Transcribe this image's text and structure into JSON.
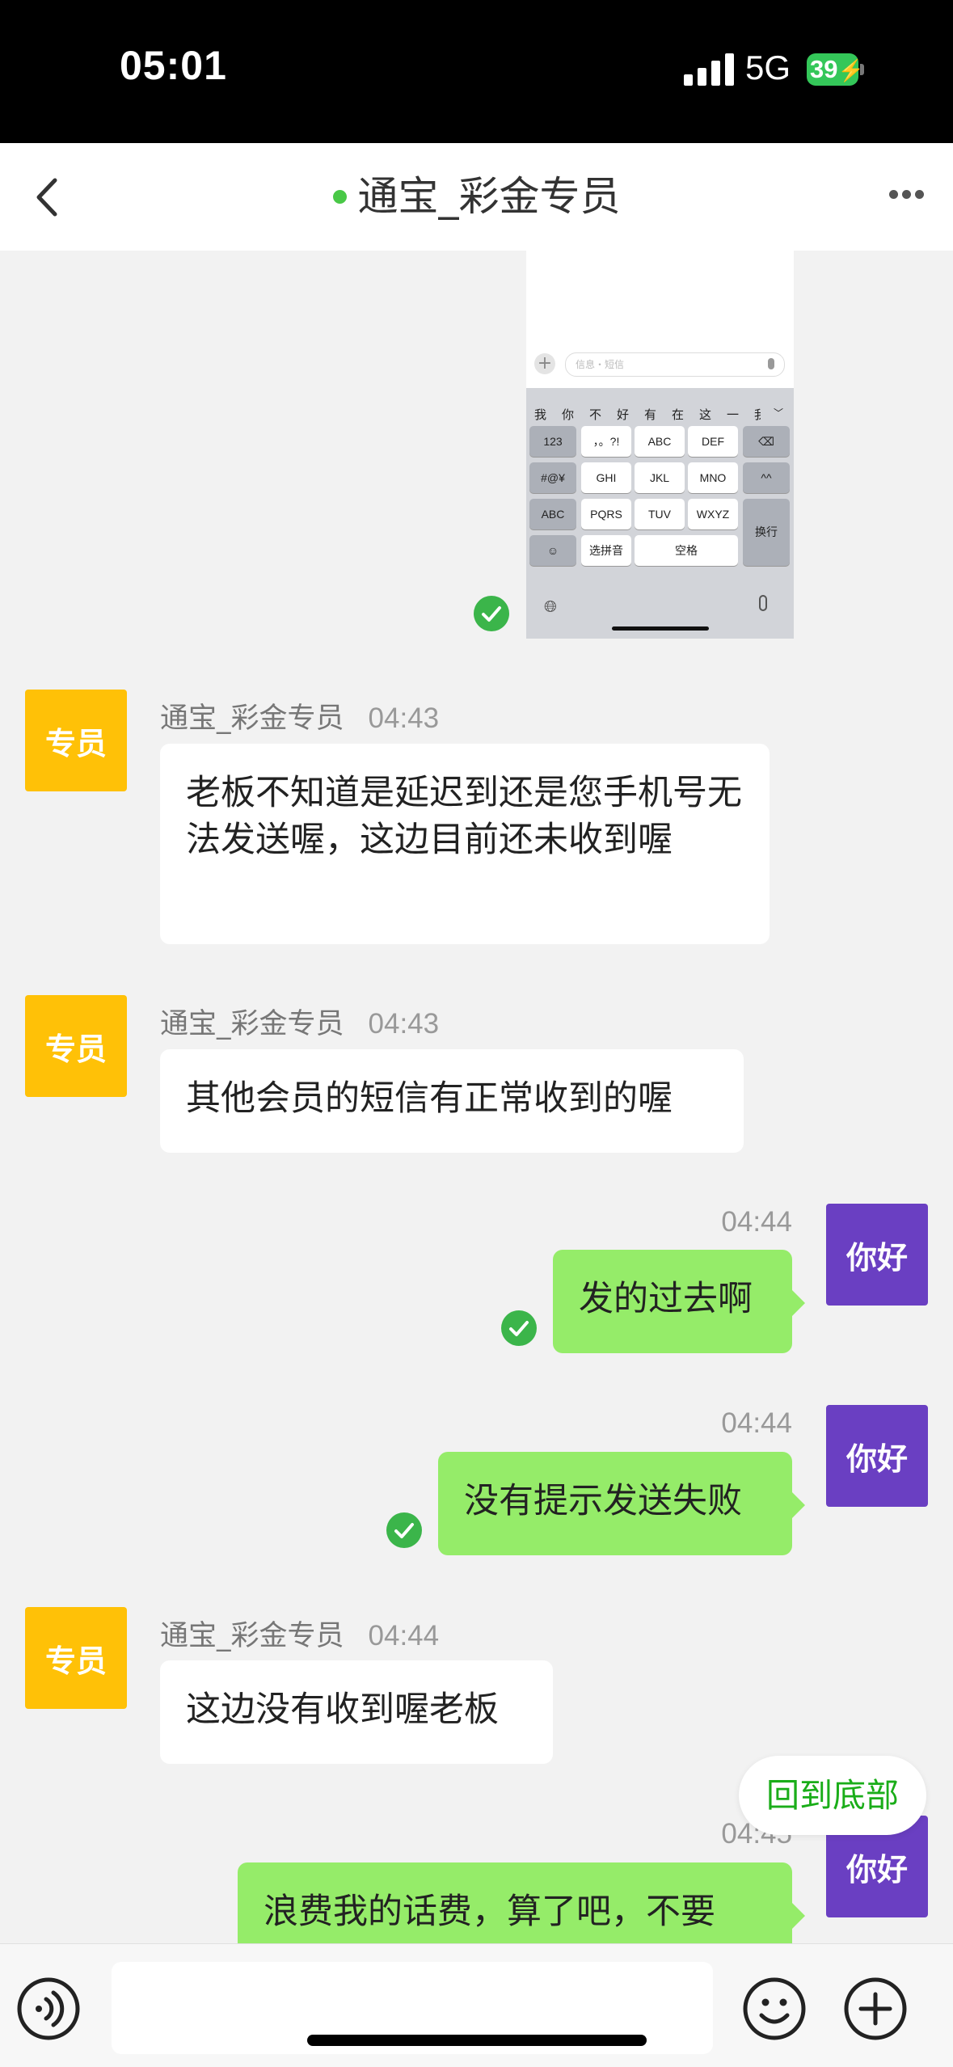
{
  "status_bar": {
    "time": "05:01",
    "network": "5G",
    "battery": "39"
  },
  "nav": {
    "title": "通宝_彩金专员",
    "online_color": "#49c847"
  },
  "image_message": {
    "input_placeholder": "信息・短信",
    "candidates": [
      "我",
      "你",
      "不",
      "好",
      "有",
      "在",
      "这",
      "一",
      "我"
    ],
    "keys": {
      "k123": "123",
      "punct": "，。?!",
      "abc": "ABC",
      "def": "DEF",
      "sym": "#@¥",
      "ghi": "GHI",
      "jkl": "JKL",
      "mno": "MNO",
      "face": "^^",
      "abc_mode": "ABC",
      "pqrs": "PQRS",
      "tuv": "TUV",
      "wxyz": "WXYZ",
      "return": "换行",
      "pinyin": "选拼音",
      "space": "空格"
    }
  },
  "messages": [
    {
      "side": "left",
      "avatar": "专员",
      "sender": "通宝_彩金专员",
      "time": "04:43",
      "text": "老板不知道是延迟到还是您手机号无法发送喔，这边目前还未收到喔"
    },
    {
      "side": "left",
      "avatar": "专员",
      "sender": "通宝_彩金专员",
      "time": "04:43",
      "text": "其他会员的短信有正常收到的喔"
    },
    {
      "side": "right",
      "avatar": "你好",
      "time": "04:44",
      "text": "发的过去啊"
    },
    {
      "side": "right",
      "avatar": "你好",
      "time": "04:44",
      "text": "没有提示发送失败"
    },
    {
      "side": "left",
      "avatar": "专员",
      "sender": "通宝_彩金专员",
      "time": "04:44",
      "text": "这边没有收到喔老板"
    },
    {
      "side": "right",
      "avatar": "你好",
      "time": "04:45",
      "text": "浪费我的话费，算了吧，不要"
    }
  ],
  "back_to_bottom": "回到底部",
  "input": {
    "value": "",
    "placeholder": ""
  },
  "colors": {
    "agent_avatar": "#ffc107",
    "user_avatar": "#6a3fc2",
    "sent_bubble": "#95ec69",
    "check": "#3bb54a"
  }
}
